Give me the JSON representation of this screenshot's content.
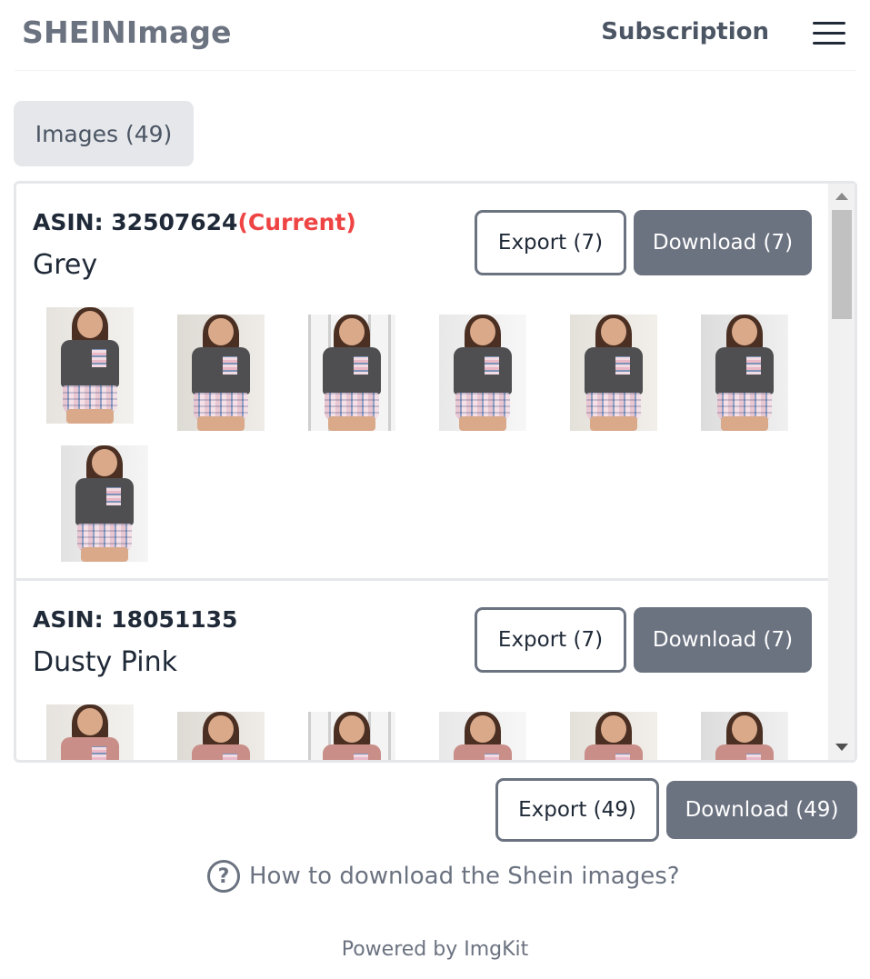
{
  "header": {
    "logo": "SHEINImage",
    "subscription_label": "Subscription",
    "menu_icon": "hamburger-menu-icon"
  },
  "tabs": [
    {
      "label": "Images (49)"
    }
  ],
  "groups": [
    {
      "asin_label": "ASIN: 32507624",
      "current_label": "(Current)",
      "color": "Grey",
      "export_label": "Export (7)",
      "download_label": "Download (7)",
      "shirt_color": "#4f4f52",
      "thumbnail_count": 7
    },
    {
      "asin_label": "ASIN: 18051135",
      "current_label": "",
      "color": "Dusty Pink",
      "export_label": "Export (7)",
      "download_label": "Download (7)",
      "shirt_color": "#c98e88",
      "thumbnail_count": 6
    }
  ],
  "footer_actions": {
    "export_all_label": "Export (49)",
    "download_all_label": "Download (49)"
  },
  "help": {
    "icon": "question-circle-icon",
    "text": "How to download the Shein images?"
  },
  "powered_by": "Powered by ImgKit",
  "colors": {
    "accent_gray": "#6b7280",
    "current_red": "#ef4444",
    "tab_bg": "#e5e7eb"
  }
}
